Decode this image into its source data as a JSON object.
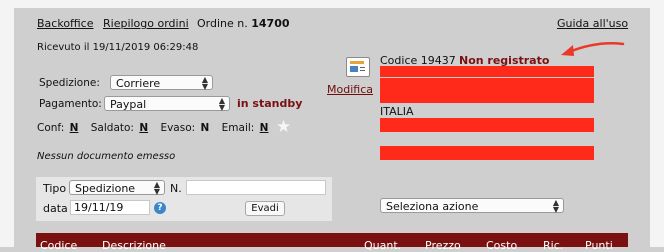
{
  "nav": {
    "backoffice": "Backoffice",
    "riepilogo": "Riepilogo ordini",
    "order_prefix": "Ordine n.",
    "order_number": "14700",
    "help": "Guida all'uso"
  },
  "received": "Ricevuto il 19/11/2019 06:29:48",
  "shipping": {
    "label": "Spedizione:",
    "value": "Corriere"
  },
  "payment": {
    "label": "Pagamento:",
    "value": "Paypal",
    "status": "in standby"
  },
  "flags": {
    "conf_label": "Conf:",
    "conf_value": "N",
    "saldato_label": "Saldato:",
    "saldato_value": "N",
    "evaso_label": "Evaso:",
    "evaso_value": "N",
    "email_label": "Email:",
    "email_value": "N"
  },
  "no_documents": "Nessun documento emesso",
  "doc_form": {
    "tipo_label": "Tipo",
    "tipo_value": "Spedizione",
    "n_label": "N.",
    "n_value": "",
    "data_label": "data",
    "data_value": "19/11/19",
    "help_glyph": "?",
    "evadi_label": "Evadi"
  },
  "customer": {
    "code_text": "Codice 19437",
    "registration": "Non registrato",
    "country": "ITALIA",
    "modify_label": "Modifica"
  },
  "action_select": {
    "value": "Seleziona azione"
  },
  "table_headers": [
    "Codice",
    "Descrizione",
    "Quant.",
    "Prezzo",
    "Costo",
    "Ric.",
    "Punti"
  ],
  "colors": {
    "accent": "#7a1010",
    "redaction": "#ff2a1a",
    "arrow": "#e8392b"
  },
  "icons": {
    "modify": "address-card-icon",
    "star": "star-icon",
    "help": "help-circle-icon"
  }
}
